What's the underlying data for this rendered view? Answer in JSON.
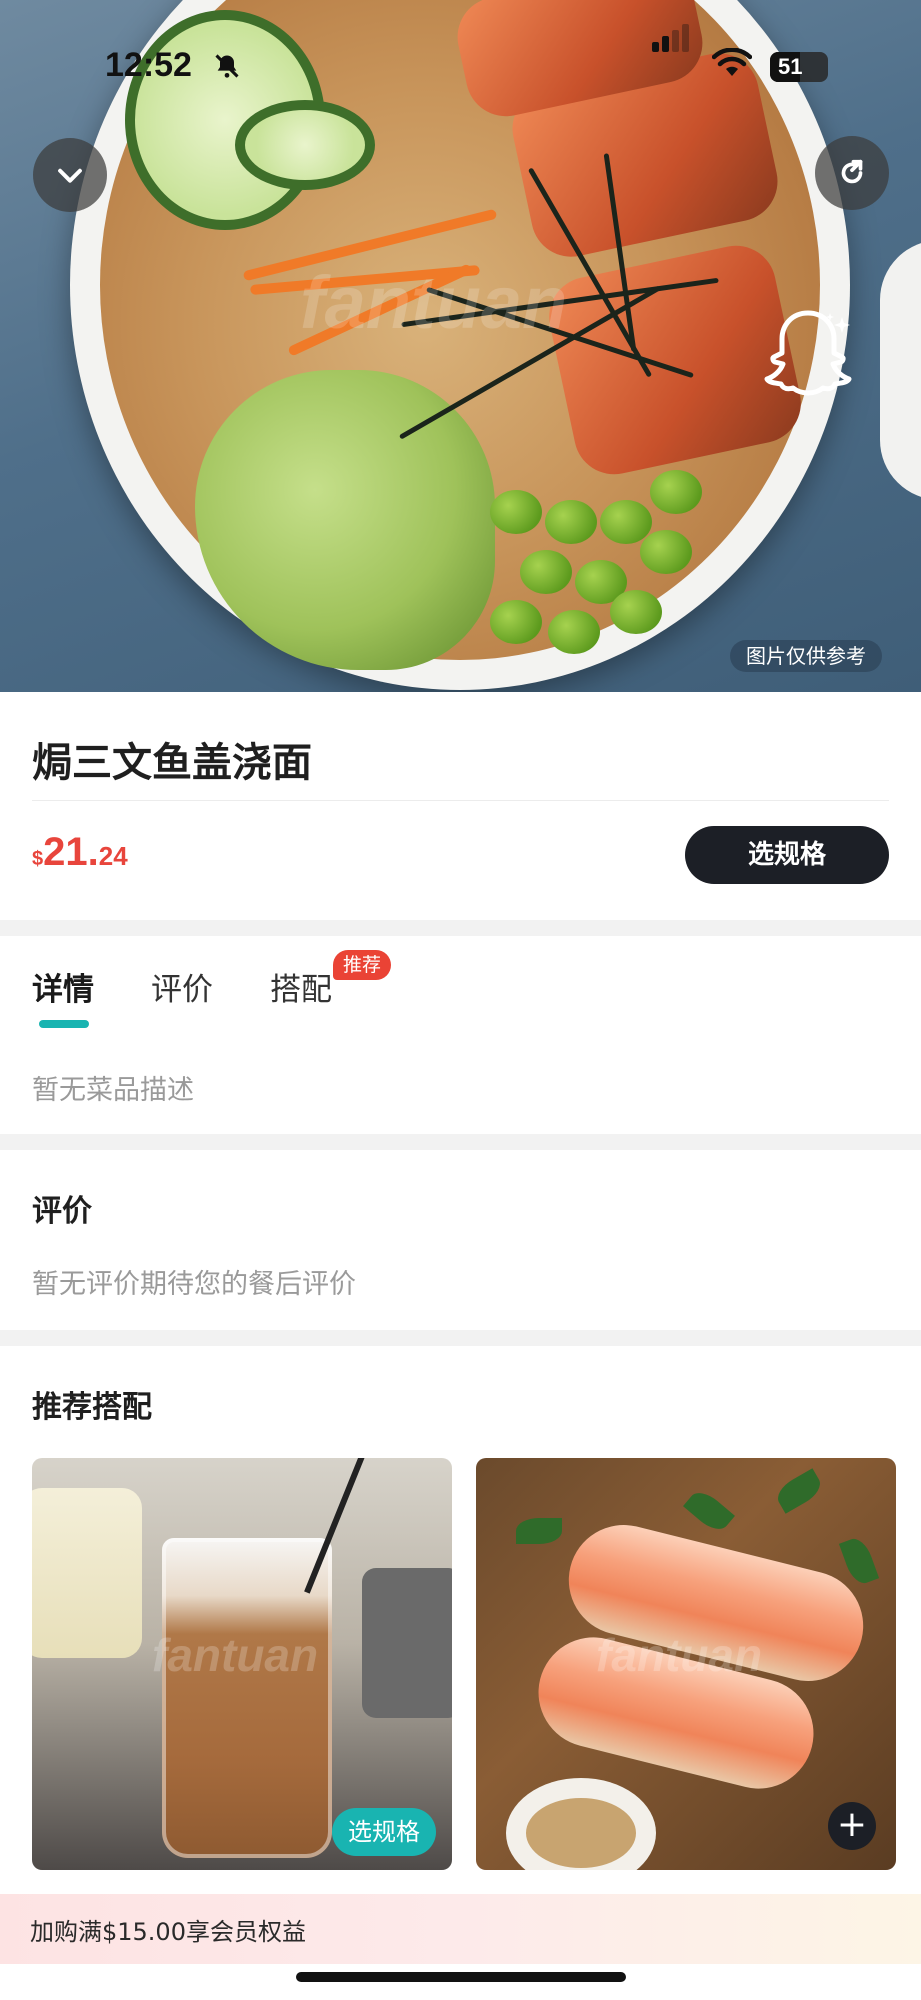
{
  "status_bar": {
    "time": "12:52",
    "battery": "51"
  },
  "hero": {
    "image_note": "图片仅供参考",
    "watermark": "fantuan"
  },
  "dish": {
    "title": "焗三文鱼盖浇面",
    "price_currency": "$",
    "price_main": "21.",
    "price_decimal": "24",
    "spec_button": "选规格"
  },
  "tabs": [
    {
      "label": "详情"
    },
    {
      "label": "评价"
    },
    {
      "label": "搭配",
      "badge": "推荐"
    }
  ],
  "details": {
    "description": "暂无菜品描述"
  },
  "review": {
    "title": "评价",
    "empty_text": "暂无评价期待您的餐后评价"
  },
  "recommend": {
    "title": "推荐搭配",
    "items": [
      {
        "watermark": "fantuan",
        "action": "选规格"
      },
      {
        "watermark": "fantuan",
        "action": "+"
      }
    ]
  },
  "promo": {
    "text": "加购满$15.00享会员权益"
  },
  "colors": {
    "accent": "#19b4b1",
    "price": "#e8453c",
    "dark_button": "#1c1f26",
    "badge": "#ea4335"
  }
}
